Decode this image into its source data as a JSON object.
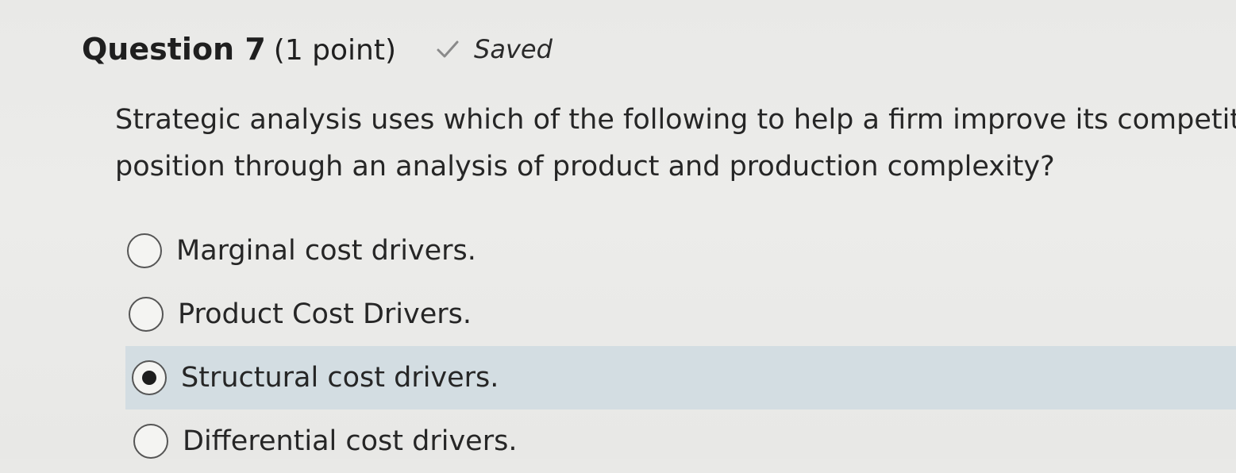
{
  "question": {
    "title": "Question 7",
    "points": "(1 point)",
    "status": "Saved",
    "status_icon": "check-icon",
    "prompt_line1": "Strategic analysis uses which of the following to help a firm improve its competit",
    "prompt_line2": "position through an analysis of product and production complexity?"
  },
  "options": [
    {
      "label": "Marginal cost drivers.",
      "selected": false
    },
    {
      "label": "Product Cost Drivers.",
      "selected": false
    },
    {
      "label": "Structural cost drivers.",
      "selected": true
    },
    {
      "label": "Differential cost drivers.",
      "selected": false
    }
  ],
  "colors": {
    "selected_row": "#d3dde2",
    "background": "#e9e9e7"
  }
}
